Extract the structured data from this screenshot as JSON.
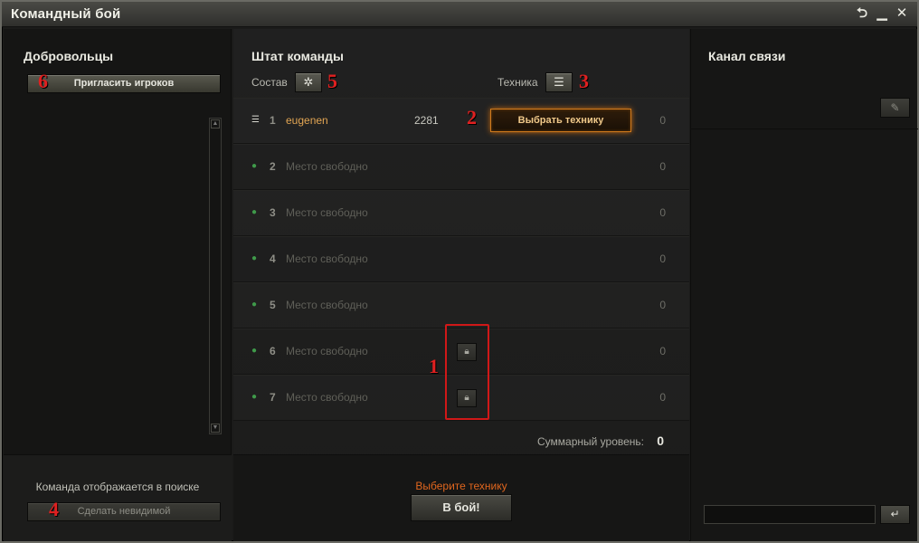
{
  "window": {
    "title": "Командный бой",
    "controls": [
      "back-icon",
      "minimize-icon",
      "close-icon"
    ],
    "control_glyphs": [
      "⮌",
      "▁",
      "✕"
    ]
  },
  "left": {
    "title": "Добровольцы",
    "invite_button": "Пригласить игроков",
    "status_text": "Команда отображается в поиске",
    "invisible_button": "Сделать невидимой"
  },
  "center": {
    "title": "Штат команды",
    "roster_label": "Состав",
    "vehicles_label": "Техника",
    "slots": [
      {
        "num": "1",
        "name": "eugenen",
        "rating": "2281",
        "level": "0",
        "taken": true
      },
      {
        "num": "2",
        "name": "Место свободно",
        "level": "0",
        "taken": false
      },
      {
        "num": "3",
        "name": "Место свободно",
        "level": "0",
        "taken": false
      },
      {
        "num": "4",
        "name": "Место свободно",
        "level": "0",
        "taken": false
      },
      {
        "num": "5",
        "name": "Место свободно",
        "level": "0",
        "taken": false
      },
      {
        "num": "6",
        "name": "Место свободно",
        "level": "0",
        "taken": false,
        "locked": true
      },
      {
        "num": "7",
        "name": "Место свободно",
        "level": "0",
        "taken": false,
        "locked": true
      }
    ],
    "select_vehicle_button": "Выбрать технику",
    "total_label": "Суммарный уровень:",
    "total_value": "0",
    "hint": "Выберите технику",
    "battle_button": "В бой!"
  },
  "right": {
    "title": "Канал связи",
    "chat_input": ""
  },
  "markers": {
    "m1": "1",
    "m2": "2",
    "m3": "3",
    "m4": "4",
    "m5": "5",
    "m6": "6"
  },
  "colors": {
    "accent_orange": "#e0661e",
    "player_name": "#e2a553",
    "annotation_red": "#e02020"
  }
}
